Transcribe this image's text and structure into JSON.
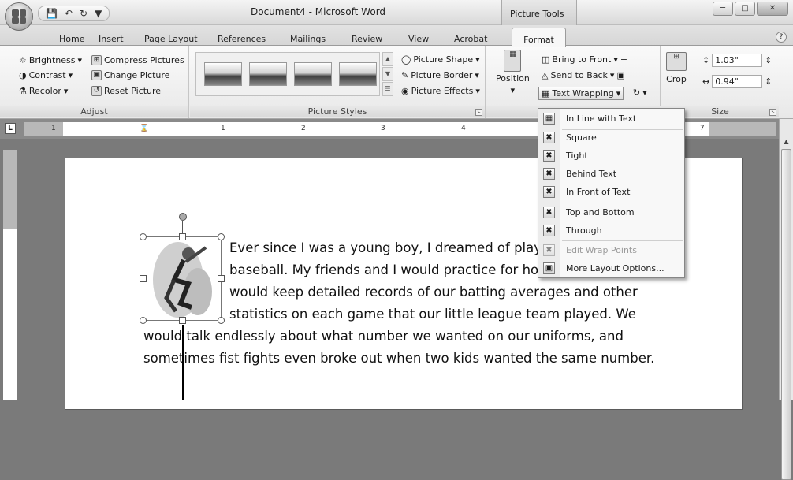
{
  "window": {
    "title": "Document4 - Microsoft Word",
    "context_tab_title": "Picture Tools",
    "controls": [
      "minimize",
      "maximize",
      "close"
    ]
  },
  "qat": {
    "save": "save-icon",
    "undo": "undo-icon",
    "redo": "redo-icon",
    "customize": "customize-icon"
  },
  "tabs": [
    "Home",
    "Insert",
    "Page Layout",
    "References",
    "Mailings",
    "Review",
    "View",
    "Acrobat"
  ],
  "active_tab": "Format",
  "ribbon": {
    "adjust": {
      "label": "Adjust",
      "brightness": "Brightness",
      "contrast": "Contrast",
      "recolor": "Recolor",
      "compress": "Compress Pictures",
      "change": "Change Picture",
      "reset": "Reset Picture"
    },
    "styles": {
      "label": "Picture Styles",
      "shape": "Picture Shape",
      "border": "Picture Border",
      "effects": "Picture Effects"
    },
    "arrange": {
      "position": "Position",
      "bring_front": "Bring to Front",
      "send_back": "Send to Back",
      "text_wrapping": "Text Wrapping"
    },
    "size": {
      "label": "Size",
      "crop": "Crop",
      "height": "1.03\"",
      "width": "0.94\""
    }
  },
  "ruler": {
    "numbers": [
      "1",
      "1",
      "2",
      "3",
      "4",
      "7"
    ]
  },
  "document": {
    "lines": [
      "Ever since I was a young boy, I dreamed of playin",
      "baseball.  My friends and I would practice for hou",
      "would keep detailed  records of our batting averages and other",
      "statistics on each game that our little league team played.  We",
      "would talk endlessly about what number we wanted on our uniforms, and",
      "sometimes fist fights even broke out when two kids wanted the same number."
    ]
  },
  "menu": {
    "items": [
      {
        "label": "In Line with Text",
        "enabled": true
      },
      {
        "label": "Square",
        "enabled": true
      },
      {
        "label": "Tight",
        "enabled": true
      },
      {
        "label": "Behind Text",
        "enabled": true
      },
      {
        "label": "In Front of Text",
        "enabled": true
      },
      {
        "label": "Top and Bottom",
        "enabled": true
      },
      {
        "label": "Through",
        "enabled": true
      },
      {
        "label": "Edit Wrap Points",
        "enabled": false
      },
      {
        "label": "More Layout Options...",
        "enabled": true
      }
    ]
  }
}
